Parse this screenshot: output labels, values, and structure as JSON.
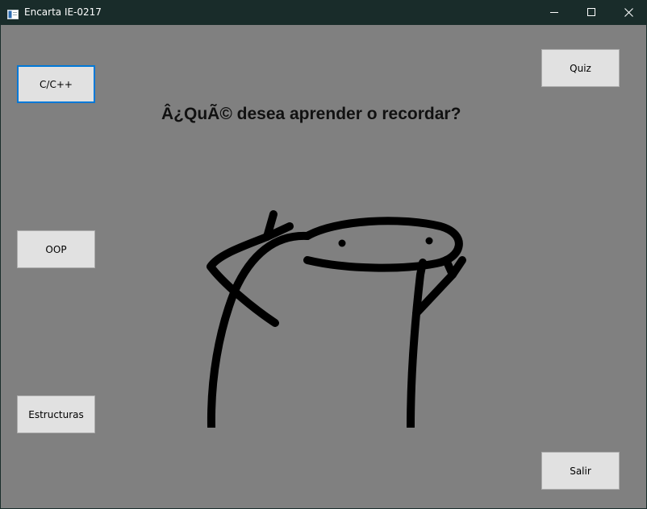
{
  "window": {
    "title": "Encarta IE-0217",
    "controls": {
      "minimize_icon": "minimize-icon",
      "maximize_icon": "maximize-icon",
      "close_icon": "close-icon"
    }
  },
  "main": {
    "heading": "Â¿QuÃ© desea aprender o recordar?",
    "buttons": {
      "cpp": "C/C++",
      "oop": "OOP",
      "estructuras": "Estructuras",
      "quiz": "Quiz",
      "salir": "Salir"
    },
    "illustration": "stick-figure-meme"
  },
  "colors": {
    "titlebar": "#192c2a",
    "client_background": "#808080",
    "button_face": "#e1e1e1",
    "focus_border": "#0078d7"
  }
}
